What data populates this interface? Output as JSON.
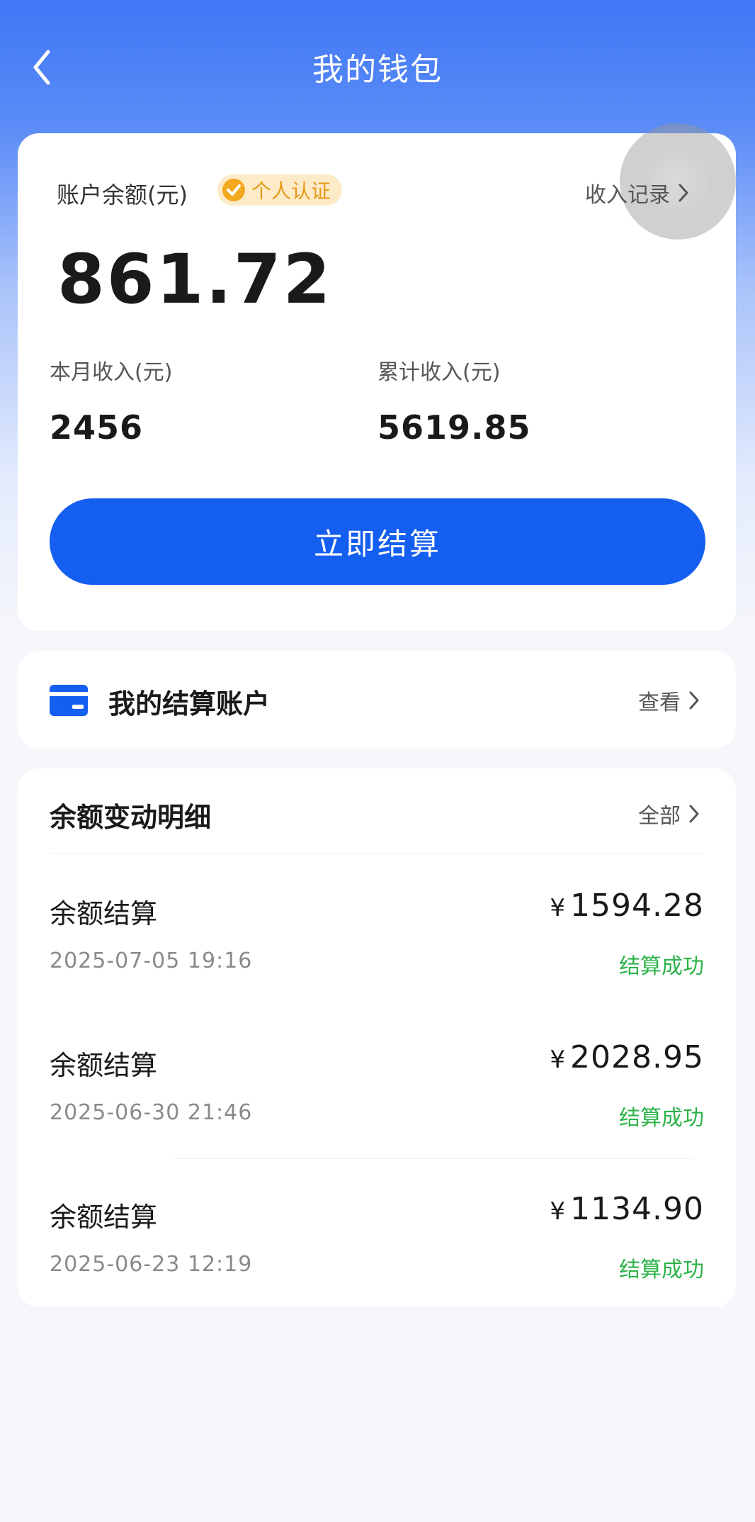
{
  "header": {
    "title": "我的钱包"
  },
  "balance": {
    "label": "账户余额(元)",
    "badge": "个人认证",
    "income_link": "收入记录",
    "amount": "861.72",
    "monthly_label": "本月收入(元)",
    "monthly_value": "2456",
    "total_label": "累计收入(元)",
    "total_value": "5619.85",
    "settle_button": "立即结算"
  },
  "account": {
    "title": "我的结算账户",
    "view": "查看"
  },
  "details": {
    "title": "余额变动明细",
    "all": "全部",
    "currency": "¥",
    "items": [
      {
        "name": "余额结算",
        "time": "2025-07-05 19:16",
        "amount": "1594.28",
        "status": "结算成功"
      },
      {
        "name": "余额结算",
        "time": "2025-06-30 21:46",
        "amount": "2028.95",
        "status": "结算成功"
      },
      {
        "name": "余额结算",
        "time": "2025-06-23 12:19",
        "amount": "1134.90",
        "status": "结算成功"
      }
    ]
  },
  "colors": {
    "primary": "#145ef0",
    "success": "#2db34a",
    "badge": "#e59a1a",
    "header": "#3f77f5"
  },
  "icons": {
    "back": "chevron-left-icon",
    "badge": "check-circle-icon",
    "account": "wallet-card-icon",
    "link": "chevron-right-icon"
  }
}
